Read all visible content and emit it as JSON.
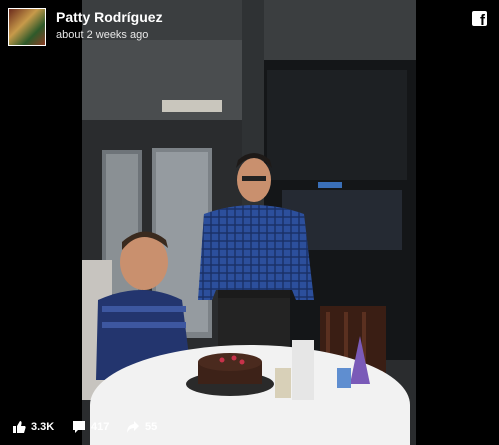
{
  "post": {
    "author_name": "Patty Rodríguez",
    "timestamp": "about 2 weeks ago"
  },
  "icons": {
    "brand": "facebook-icon",
    "likes": "thumbs-up-icon",
    "comments": "comment-icon",
    "shares": "share-arrow-icon"
  },
  "stats": {
    "likes": "3.3K",
    "comments": "417",
    "shares": "55"
  },
  "colors": {
    "background": "#000000",
    "text": "#ffffff",
    "shirt_blue": "#2c4f9c"
  }
}
